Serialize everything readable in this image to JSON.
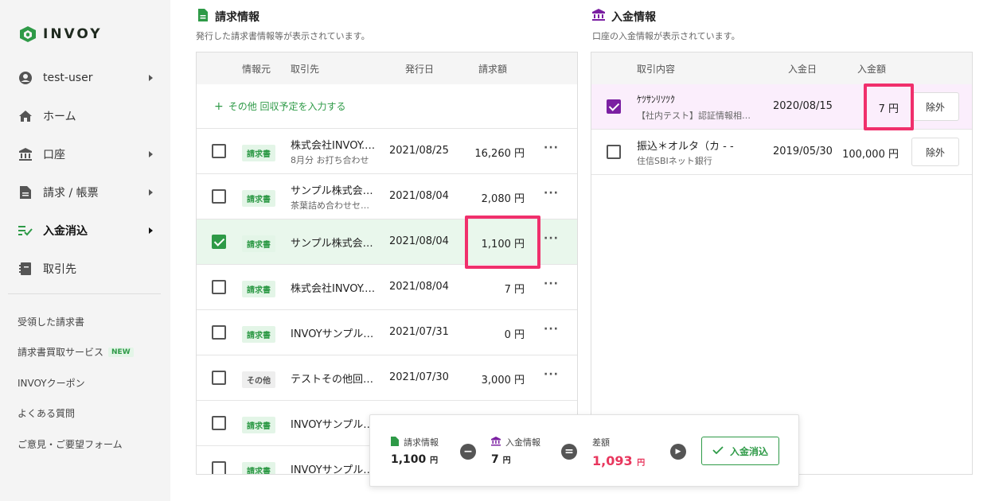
{
  "brand": {
    "name": "INVOY"
  },
  "sidebar": {
    "items": [
      {
        "label": "test-user",
        "icon": "user-circle-icon",
        "arrow": true
      },
      {
        "label": "ホーム",
        "icon": "home-icon",
        "arrow": false
      },
      {
        "label": "口座",
        "icon": "bank-icon",
        "arrow": true
      },
      {
        "label": "請求 / 帳票",
        "icon": "document-icon",
        "arrow": true
      },
      {
        "label": "入金消込",
        "icon": "reconcile-icon",
        "arrow": true,
        "active": true
      },
      {
        "label": "取引先",
        "icon": "contacts-book-icon",
        "arrow": false
      }
    ],
    "links": [
      {
        "label": "受領した請求書"
      },
      {
        "label": "請求書買取サービス",
        "badge": "NEW"
      },
      {
        "label": "INVOYクーポン"
      },
      {
        "label": "よくある質問"
      },
      {
        "label": "ご意見・ご要望フォーム"
      }
    ]
  },
  "invoices": {
    "title": "請求情報",
    "subtitle": "発行した請求書情報等が表示されています。",
    "columns": {
      "source": "情報元",
      "client": "取引先",
      "date": "発行日",
      "amount": "請求額"
    },
    "add_label": "その他 回収予定を入力する",
    "rows": [
      {
        "checked": false,
        "type": "請求書",
        "client": "株式会社INVOY.…",
        "note": "8月分 お打ち合わせ",
        "date": "2021/08/25",
        "amount": "16,260 円"
      },
      {
        "checked": false,
        "type": "請求書",
        "client": "サンプル株式会…",
        "note": "茶葉詰め合わせセ…",
        "date": "2021/08/04",
        "amount": "2,080 円"
      },
      {
        "checked": true,
        "type": "請求書",
        "client": "サンプル株式会…",
        "note": "",
        "date": "2021/08/04",
        "amount": "1,100 円"
      },
      {
        "checked": false,
        "type": "請求書",
        "client": "株式会社INVOY.…",
        "note": "",
        "date": "2021/08/04",
        "amount": "7 円"
      },
      {
        "checked": false,
        "type": "請求書",
        "client": "INVOYサンプル…",
        "note": "",
        "date": "2021/07/31",
        "amount": "0 円"
      },
      {
        "checked": false,
        "type": "その他",
        "client": "テストその他回…",
        "note": "",
        "date": "2021/07/30",
        "amount": "3,000 円"
      },
      {
        "checked": false,
        "type": "請求書",
        "client": "INVOYサンプル…",
        "note": "",
        "date": "",
        "amount": ""
      },
      {
        "checked": false,
        "type": "請求書",
        "client": "INVOYサンプル…",
        "note": "",
        "date": "",
        "amount": ""
      }
    ]
  },
  "payments": {
    "title": "入金情報",
    "subtitle": "口座の入金情報が表示されています。",
    "columns": {
      "desc": "取引内容",
      "date": "入金日",
      "amount": "入金額"
    },
    "rows": [
      {
        "checked": true,
        "desc": "ｹﾂｻﾝﾘｿﾂｸ",
        "note": "【社内テスト】認証情報相…",
        "date": "2020/08/15",
        "amount": "7 円",
        "exclude": "除外"
      },
      {
        "checked": false,
        "desc": "振込＊オルタ（カ - -",
        "note": "住信SBIネット銀行",
        "date": "2019/05/30",
        "amount": "100,000 円",
        "exclude": "除外"
      }
    ]
  },
  "summary": {
    "invoice_label": "請求情報",
    "invoice_value": "1,100",
    "payment_label": "入金情報",
    "payment_value": "7",
    "diff_label": "差額",
    "diff_value": "1,093",
    "unit": "円",
    "button_label": "入金消込"
  },
  "colors": {
    "green": "#2e9a47",
    "purple": "#7b1fa2",
    "highlight": "#f0306c",
    "diff": "#e8365d"
  }
}
